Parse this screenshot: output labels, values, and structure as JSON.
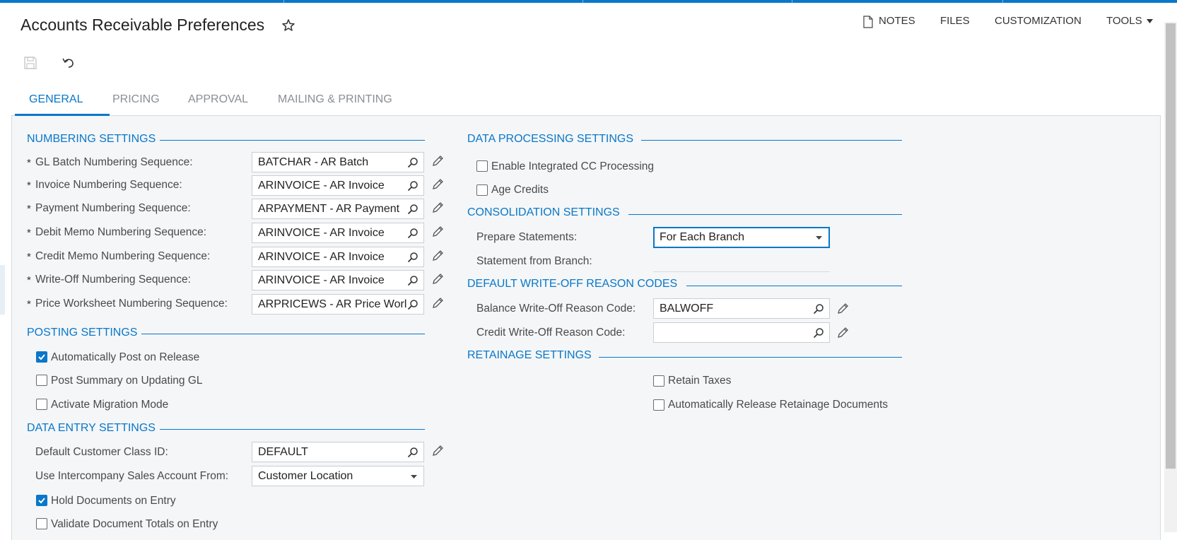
{
  "page": {
    "title": "Accounts Receivable Preferences"
  },
  "top_actions": {
    "notes": "NOTES",
    "files": "FILES",
    "customization": "CUSTOMIZATION",
    "tools": "TOOLS"
  },
  "tabs": [
    "GENERAL",
    "PRICING",
    "APPROVAL",
    "MAILING & PRINTING"
  ],
  "numbering": {
    "header": "NUMBERING SETTINGS",
    "rows": [
      {
        "label": "GL Batch Numbering Sequence:",
        "value": "BATCHAR - AR Batch"
      },
      {
        "label": "Invoice Numbering Sequence:",
        "value": "ARINVOICE - AR Invoice"
      },
      {
        "label": "Payment Numbering Sequence:",
        "value": "ARPAYMENT - AR Payment"
      },
      {
        "label": "Debit Memo Numbering Sequence:",
        "value": "ARINVOICE - AR Invoice"
      },
      {
        "label": "Credit Memo Numbering Sequence:",
        "value": "ARINVOICE - AR Invoice"
      },
      {
        "label": "Write-Off Numbering Sequence:",
        "value": "ARINVOICE - AR Invoice"
      },
      {
        "label": "Price Worksheet Numbering Sequence:",
        "value": "ARPRICEWS - AR Price Worl"
      }
    ]
  },
  "posting": {
    "header": "POSTING SETTINGS",
    "items": [
      {
        "label": "Automatically Post on Release",
        "checked": true
      },
      {
        "label": "Post Summary on Updating GL",
        "checked": false
      },
      {
        "label": "Activate Migration Mode",
        "checked": false
      }
    ]
  },
  "data_entry": {
    "header": "DATA ENTRY SETTINGS",
    "customer_class_label": "Default Customer Class ID:",
    "customer_class_value": "DEFAULT",
    "intercompany_label": "Use Intercompany Sales Account From:",
    "intercompany_value": "Customer Location",
    "items": [
      {
        "label": "Hold Documents on Entry",
        "checked": true
      },
      {
        "label": "Validate Document Totals on Entry",
        "checked": false
      }
    ]
  },
  "data_processing": {
    "header": "DATA PROCESSING SETTINGS",
    "items": [
      {
        "label": "Enable Integrated CC Processing",
        "checked": false
      },
      {
        "label": "Age Credits",
        "checked": false
      }
    ]
  },
  "consolidation": {
    "header": "CONSOLIDATION SETTINGS",
    "prepare_label": "Prepare Statements:",
    "prepare_value": "For Each Branch",
    "branch_label": "Statement from Branch:",
    "branch_value": ""
  },
  "writeoff": {
    "header": "DEFAULT WRITE-OFF REASON CODES",
    "balance_label": "Balance Write-Off Reason Code:",
    "balance_value": "BALWOFF",
    "credit_label": "Credit Write-Off Reason Code:",
    "credit_value": ""
  },
  "retainage": {
    "header": "RETAINAGE SETTINGS",
    "items": [
      {
        "label": "Retain Taxes",
        "checked": false
      },
      {
        "label": "Automatically Release Retainage Documents",
        "checked": false
      }
    ]
  },
  "colors": {
    "accent": "#0a77c9",
    "panel": "#f4f6f7"
  },
  "icons": [
    "star-icon",
    "notes-icon",
    "save-icon",
    "undo-icon",
    "lookup-icon",
    "edit-icon",
    "dropdown-icon"
  ]
}
